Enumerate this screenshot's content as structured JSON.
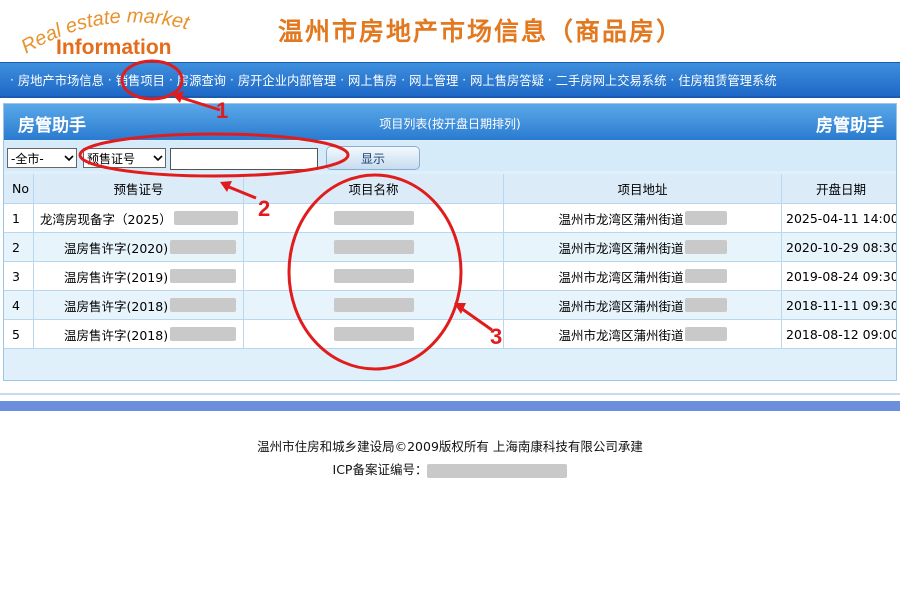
{
  "logo": {
    "line1": "Real estate market",
    "line2": "Information"
  },
  "site_title": "温州市房地产市场信息（商品房）",
  "nav": {
    "separator": "·",
    "items": [
      "房地产市场信息",
      "销售项目",
      "房源查询",
      "房开企业内部管理",
      "网上售房",
      "网上管理",
      "网上售房答疑",
      "二手房网上交易系统",
      "住房租赁管理系统"
    ]
  },
  "panel": {
    "brand_left": "房管助手",
    "subtitle": "项目列表(按开盘日期排列)",
    "brand_right": "房管助手"
  },
  "filter": {
    "city": "-全市-",
    "field": "预售证号",
    "keyword": "",
    "show_label": "显示"
  },
  "table": {
    "headers": {
      "no": "No",
      "cert": "预售证号",
      "name": "项目名称",
      "addr": "项目地址",
      "date": "开盘日期"
    },
    "rows": [
      {
        "no": "1",
        "cert": "龙湾房现备字（2025）",
        "addr": "温州市龙湾区蒲州街道",
        "date": "2025-04-11 14:00"
      },
      {
        "no": "2",
        "cert": "温房售许字(2020)",
        "addr": "温州市龙湾区蒲州街道",
        "date": "2020-10-29 08:30"
      },
      {
        "no": "3",
        "cert": "温房售许字(2019)",
        "addr": "温州市龙湾区蒲州街道",
        "date": "2019-08-24 09:30"
      },
      {
        "no": "4",
        "cert": "温房售许字(2018)",
        "addr": "温州市龙湾区蒲州街道",
        "date": "2018-11-11 09:30"
      },
      {
        "no": "5",
        "cert": "温房售许字(2018)",
        "addr": "温州市龙湾区蒲州街道",
        "date": "2018-08-12 09:00"
      }
    ]
  },
  "footer": {
    "line1": "温州市住房和城乡建设局©2009版权所有  上海南康科技有限公司承建",
    "line2": "ICP备案证编号："
  },
  "annotations": {
    "n1": "1",
    "n2": "2",
    "n3": "3"
  },
  "colors": {
    "nav": "#1e68c6",
    "title": "#e2781f",
    "annotation": "#e01c1c",
    "band": "#6c8fdd"
  }
}
